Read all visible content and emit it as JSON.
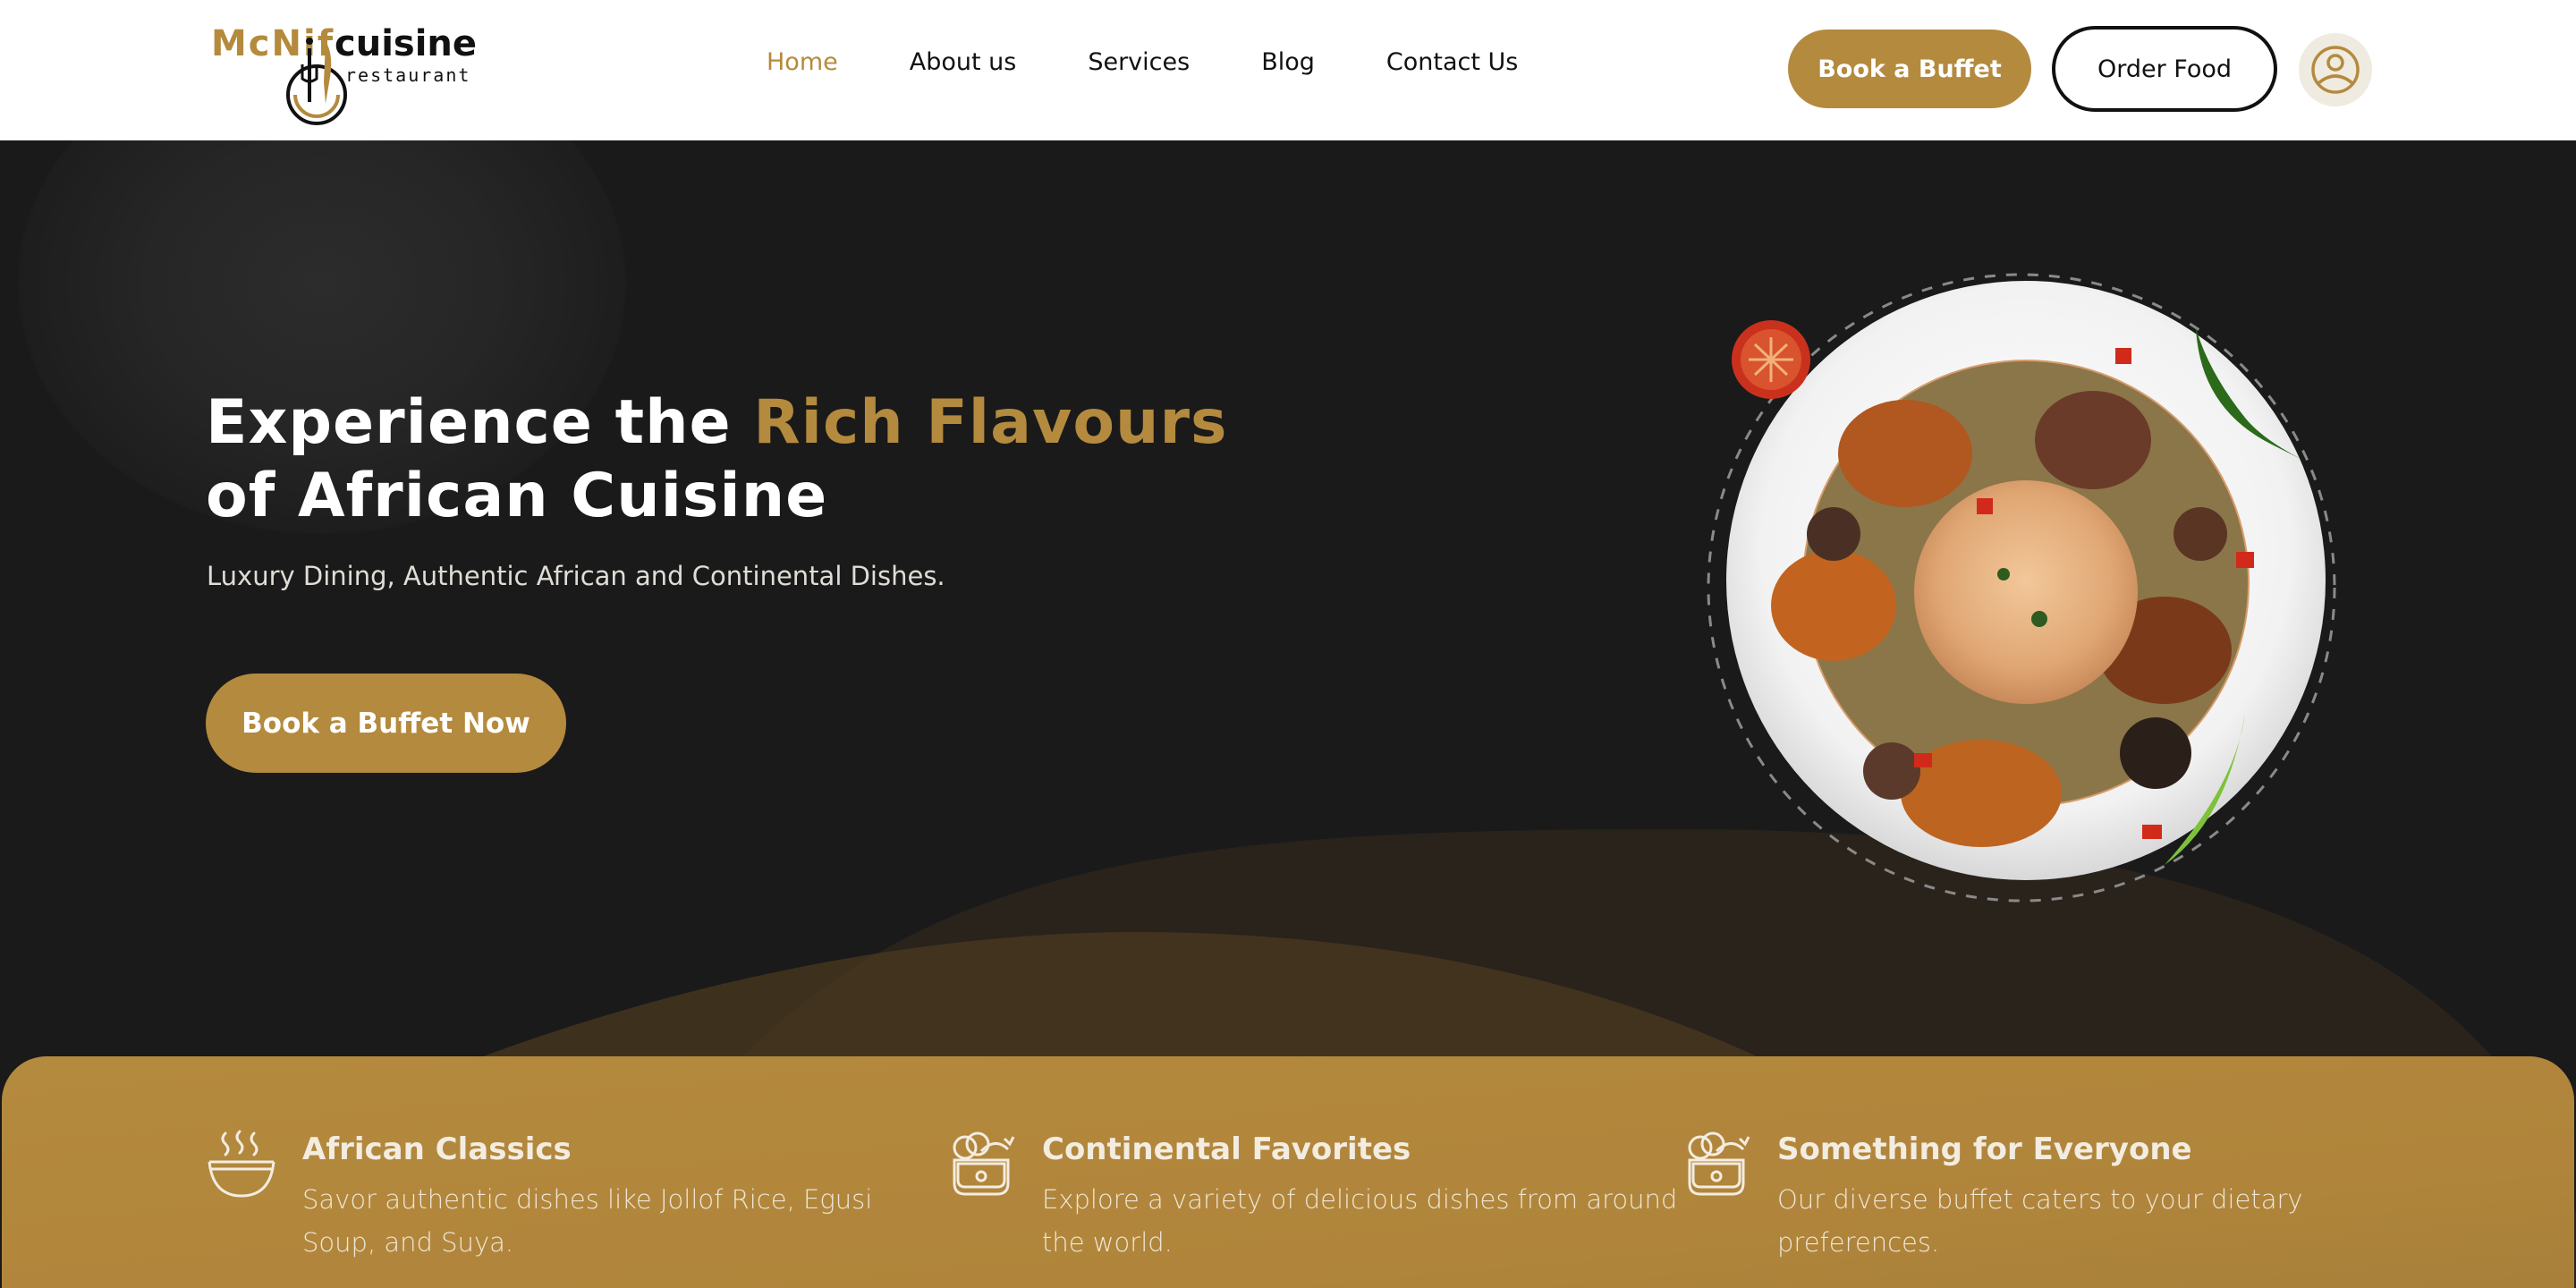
{
  "brand": {
    "name_part1": "McNif",
    "name_part2": "cuisine",
    "tagline": "restaurant",
    "accent_color": "#b48a3e",
    "dark_color": "#111111"
  },
  "nav": {
    "items": [
      {
        "label": "Home",
        "active": true
      },
      {
        "label": "About us",
        "active": false
      },
      {
        "label": "Services",
        "active": false
      },
      {
        "label": "Blog",
        "active": false
      },
      {
        "label": "Contact Us",
        "active": false
      }
    ]
  },
  "header_actions": {
    "book_buffet_label": "Book a Buffet",
    "order_food_label": "Order Food",
    "account_icon": "user-circle-icon"
  },
  "hero": {
    "headline_pre": "Experience the ",
    "headline_accent": "Rich Flavours",
    "headline_post": " of African Cuisine",
    "subheadline": "Luxury Dining, Authentic African and Continental Dishes.",
    "cta_label": "Book a Buffet Now",
    "image_alt": "Plate of jollof rice with chicken, mushrooms and greens",
    "background_color": "#1a1a1a"
  },
  "features": [
    {
      "icon": "steaming-bowl-icon",
      "title": "African Classics",
      "text": "Savor authentic dishes like Jollof Rice, Egusi Soup, and Suya."
    },
    {
      "icon": "food-basket-icon",
      "title": "Continental Favorites",
      "text": "Explore a variety of delicious dishes from around the world."
    },
    {
      "icon": "food-basket-icon",
      "title": "Something for Everyone",
      "text": "Our diverse buffet caters to your dietary preferences."
    }
  ]
}
